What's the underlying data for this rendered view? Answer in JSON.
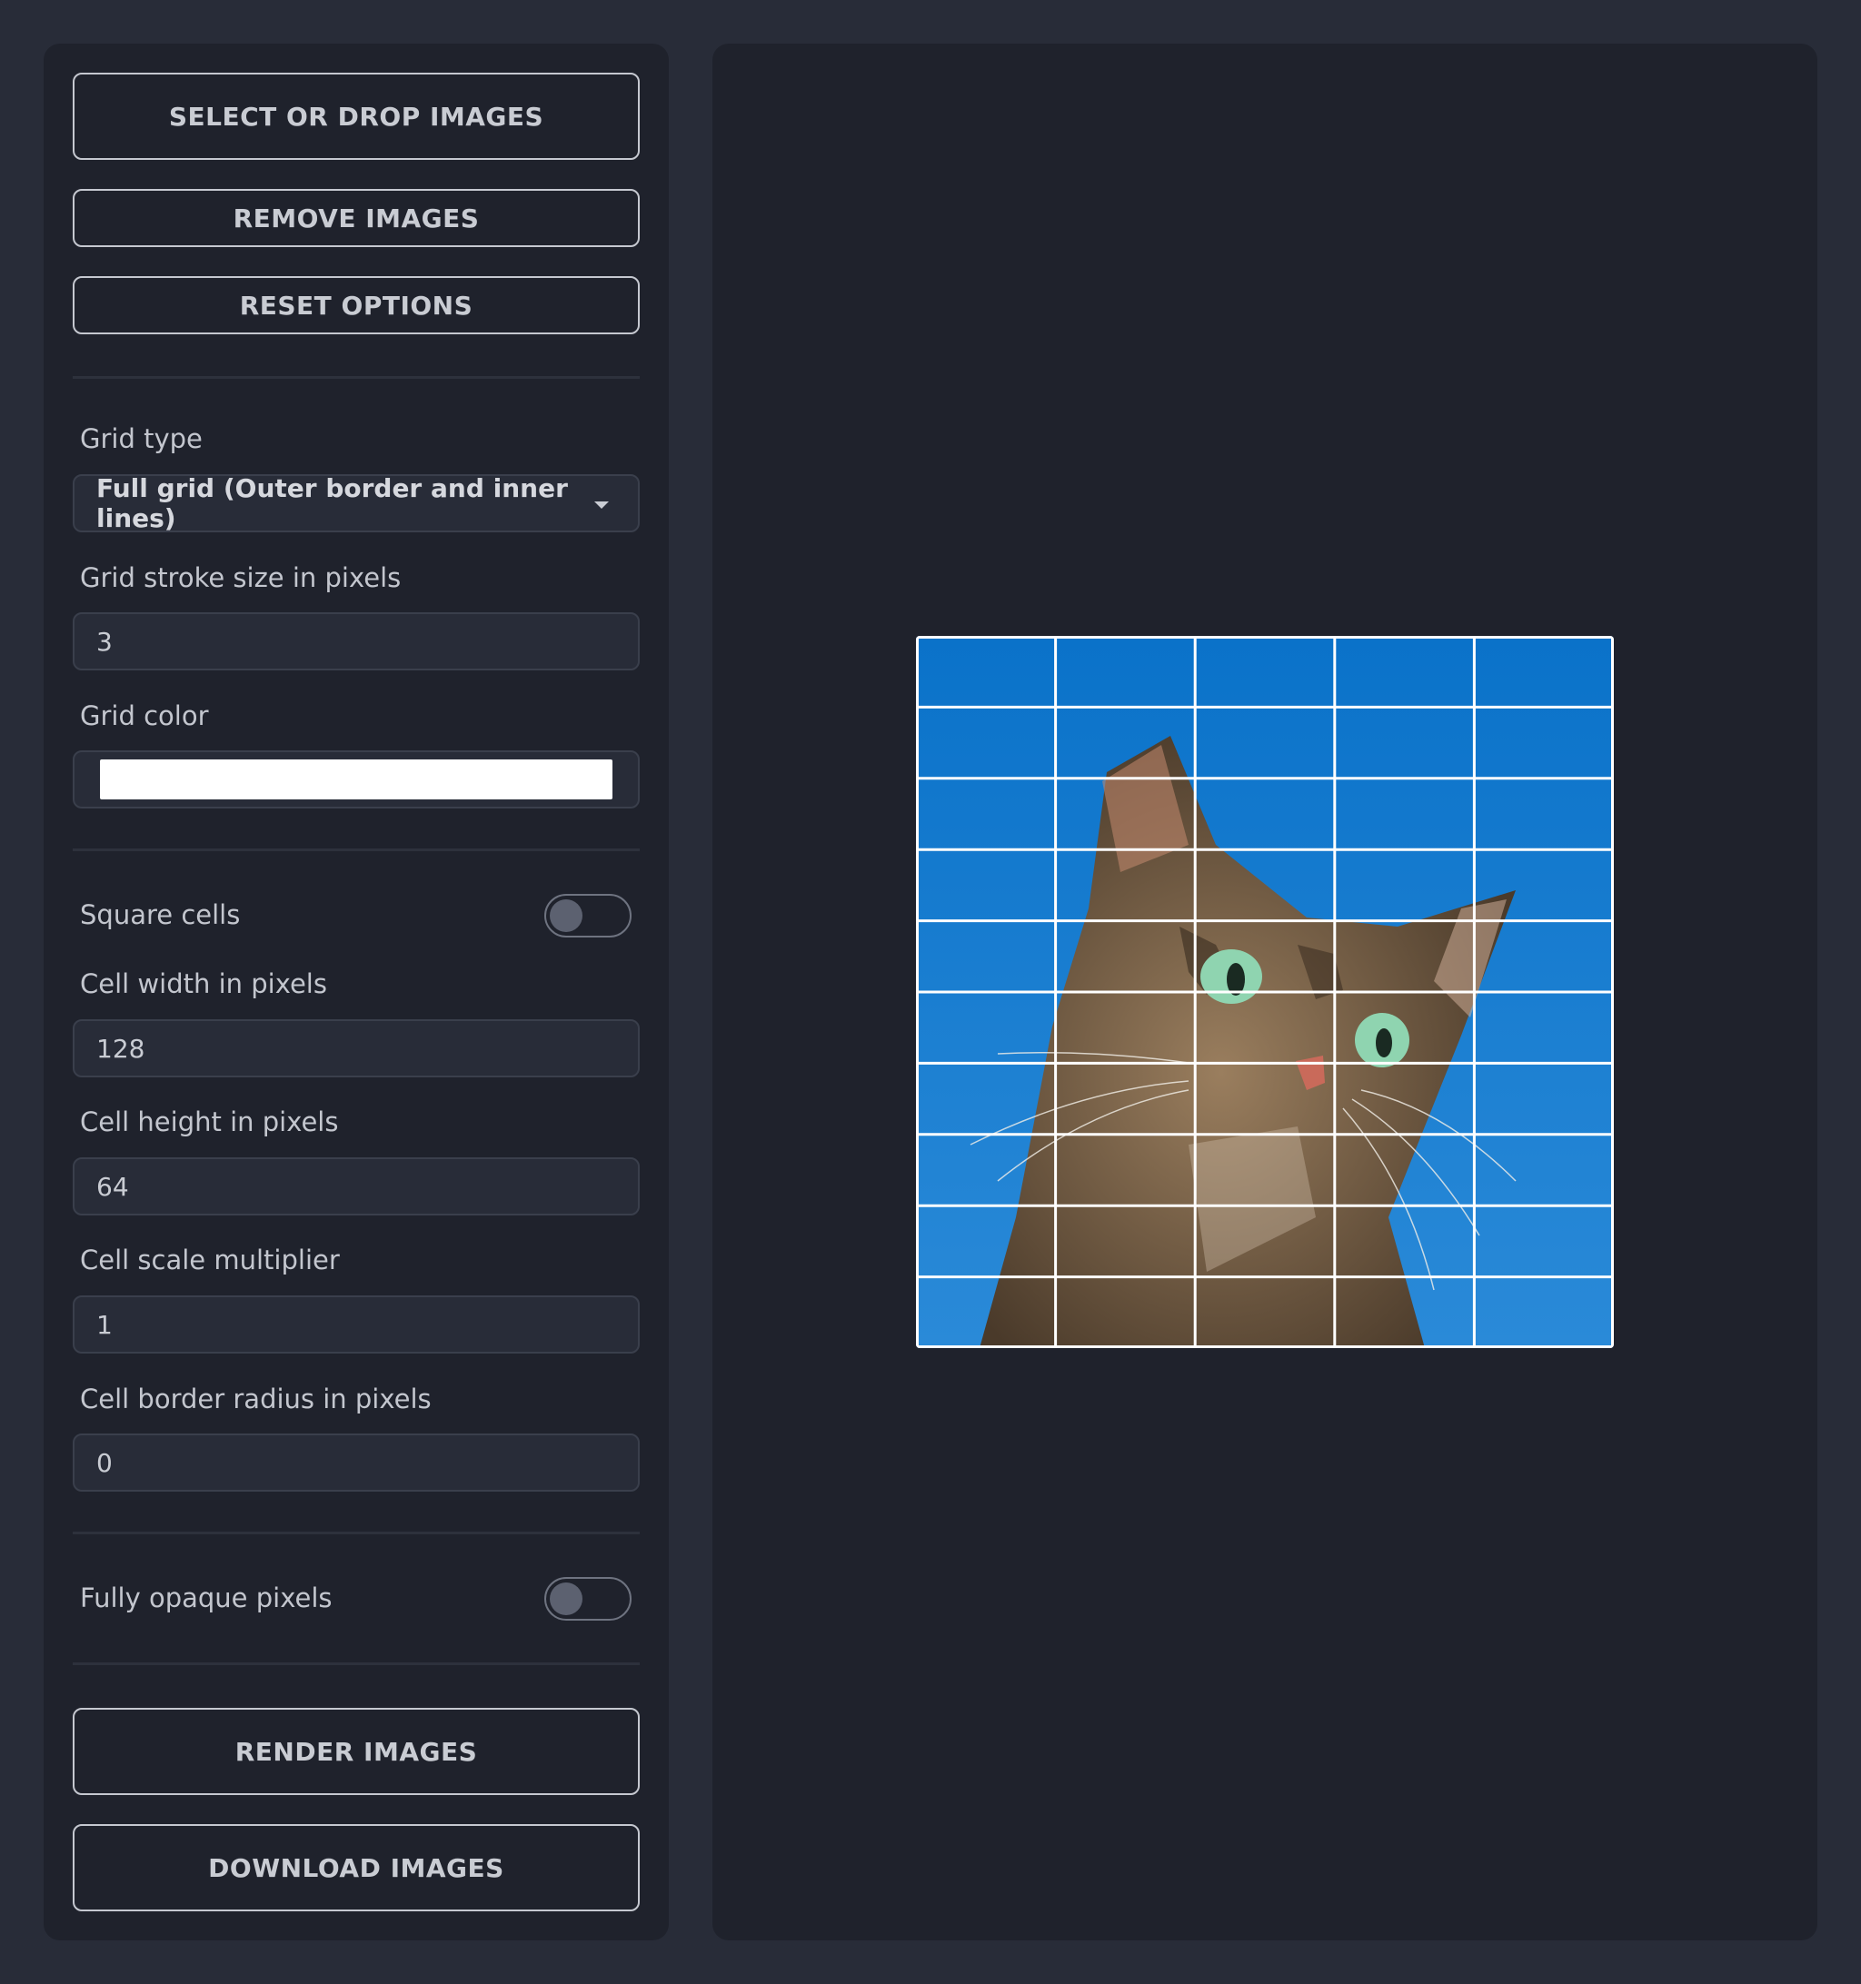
{
  "buttons": {
    "select_images": "SELECT OR DROP IMAGES",
    "remove_images": "REMOVE IMAGES",
    "reset_options": "RESET OPTIONS",
    "render_images": "RENDER IMAGES",
    "download_images": "DOWNLOAD IMAGES"
  },
  "options": {
    "grid_type": {
      "label": "Grid type",
      "value": "Full grid (Outer border and inner lines)"
    },
    "grid_stroke": {
      "label": "Grid stroke size in pixels",
      "value": "3"
    },
    "grid_color": {
      "label": "Grid color",
      "value": "#ffffff"
    },
    "square_cells": {
      "label": "Square cells",
      "enabled": false
    },
    "cell_width": {
      "label": "Cell width in pixels",
      "value": "128"
    },
    "cell_height": {
      "label": "Cell height in pixels",
      "value": "64"
    },
    "cell_scale": {
      "label": "Cell scale multiplier",
      "value": "1"
    },
    "cell_radius": {
      "label": "Cell border radius in pixels",
      "value": "0"
    },
    "opaque_pixels": {
      "label": "Fully opaque pixels",
      "enabled": false
    }
  },
  "preview": {
    "grid": {
      "columns": 5,
      "rows": 10
    },
    "colors": {
      "sky_top": "#0a72c9",
      "sky_bottom": "#2a8ad8",
      "fur_dark": "#4a3a2a",
      "fur_light": "#9a7e5e",
      "eye": "#8fd4b0"
    }
  }
}
